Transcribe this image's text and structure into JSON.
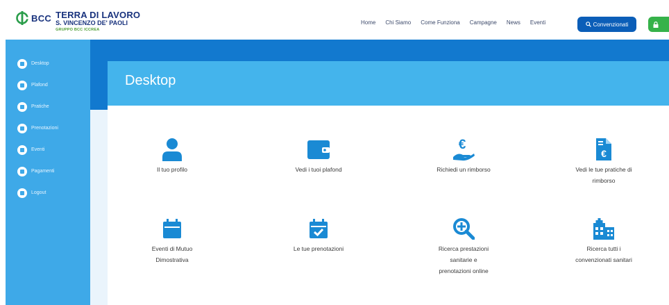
{
  "header": {
    "logo": {
      "brand": "BCC",
      "line1": "TERRA DI LAVORO",
      "line2": "S. VINCENZO DE' PAOLI",
      "line3": "GRUPPO BCC ICCREA"
    },
    "nav": [
      "Home",
      "Chi Siamo",
      "Come Funziona",
      "Campagne",
      "News",
      "Eventi"
    ],
    "conventions_button": "Convenzionati",
    "colors": {
      "primary": "#0b5eb8",
      "login": "#36b24a",
      "logo": "#18327d"
    }
  },
  "sidebar": {
    "items": [
      {
        "label": "Desktop",
        "icon": "desktop-icon"
      },
      {
        "label": "Plafond",
        "icon": "plafond-icon"
      },
      {
        "label": "Pratiche",
        "icon": "pratiche-icon"
      },
      {
        "label": "Prenotazioni",
        "icon": "prenotazioni-icon"
      },
      {
        "label": "Eventi",
        "icon": "eventi-icon"
      },
      {
        "label": "Pagamenti",
        "icon": "pagamenti-icon"
      },
      {
        "label": "Logout",
        "icon": "logout-icon"
      }
    ],
    "color": "#3ea9e8"
  },
  "main": {
    "title": "Desktop",
    "tiles": [
      {
        "label_lines": [
          "Il tuo profilo"
        ],
        "icon": "user-icon"
      },
      {
        "label_lines": [
          "Vedi i tuoi plafond"
        ],
        "icon": "wallet-icon"
      },
      {
        "label_lines": [
          "Richiedi un rimborso"
        ],
        "icon": "euro-hand-icon"
      },
      {
        "label_lines": [
          "Vedi le tue pratiche di",
          "rimborso"
        ],
        "icon": "euro-document-icon"
      },
      {
        "label_lines": [
          "Eventi di Mutuo",
          "Dimostrativa"
        ],
        "icon": "calendar-icon"
      },
      {
        "label_lines": [
          "Le tue prenotazioni"
        ],
        "icon": "calendar-check-icon"
      },
      {
        "label_lines": [
          "Ricerca prestazioni",
          "sanitarie e",
          "prenotazioni online"
        ],
        "icon": "search-plus-icon"
      },
      {
        "label_lines": [
          "Ricerca tutti i",
          "convenzionati sanitari"
        ],
        "icon": "hospital-icon"
      }
    ]
  }
}
